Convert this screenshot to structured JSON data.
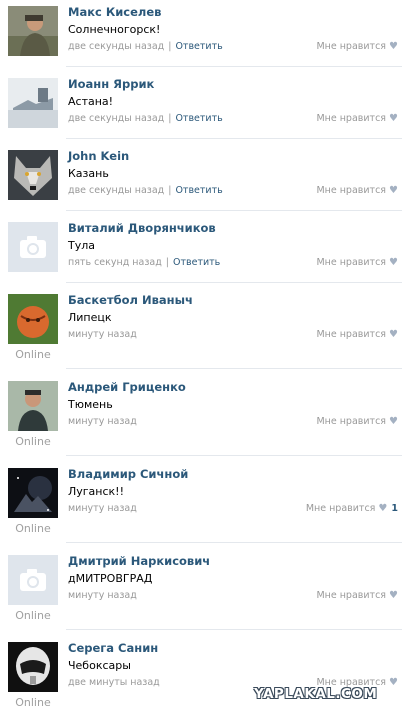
{
  "comments": [
    {
      "name": "Макс Киселев",
      "text": "Солнечногорск!",
      "time": "две секунды назад",
      "reply": "Ответить",
      "like": "Мне нравится",
      "online": "",
      "avatar_icon": "user-photo-icon"
    },
    {
      "name": "Иоанн Яррик",
      "text": "Астана!",
      "time": "две секунды назад",
      "reply": "Ответить",
      "like": "Мне нравится",
      "online": "",
      "avatar_icon": "user-photo-icon"
    },
    {
      "name": "John Kein",
      "text": "Казань",
      "time": "две секунды назад",
      "reply": "Ответить",
      "like": "Мне нравится",
      "online": "",
      "avatar_icon": "wolf-photo-icon"
    },
    {
      "name": "Виталий Дворянчиков",
      "text": "Тула",
      "time": "пять секунд назад",
      "reply": "Ответить",
      "like": "Мне нравится",
      "online": "",
      "avatar_icon": "camera-placeholder-icon"
    },
    {
      "name": "Баскетбол Иваныч",
      "text": "Липецк",
      "time": "минуту назад",
      "reply": "",
      "like": "Мне нравится",
      "online": "Online",
      "avatar_icon": "basketball-photo-icon"
    },
    {
      "name": "Андрей Гриценко",
      "text": "Тюмень",
      "time": "минуту назад",
      "reply": "",
      "like": "Мне нравится",
      "online": "Online",
      "avatar_icon": "user-photo-icon"
    },
    {
      "name": "Владимир Сичной",
      "text": "Луганск!!",
      "time": "минуту назад",
      "reply": "",
      "like": "Мне нравится",
      "like_count": "1",
      "online": "Online",
      "avatar_icon": "space-photo-icon"
    },
    {
      "name": "Дмитрий Наркисович",
      "text": "дМИТРОВГРАД",
      "time": "минуту назад",
      "reply": "",
      "like": "Мне нравится",
      "online": "Online",
      "avatar_icon": "camera-placeholder-icon"
    },
    {
      "name": "Серега Санин",
      "text": "Чебоксары",
      "time": "две минуты назад",
      "reply": "",
      "like": "Мне нравится",
      "online": "Online",
      "avatar_icon": "helmet-photo-icon"
    }
  ],
  "watermark": "YAPLAKAL.COM",
  "colors": {
    "name": "#2b587a",
    "meta": "#999999",
    "separator": "#e4e8ed",
    "placeholder_bg": "#dfe5ec",
    "heart": "#a4b1c2"
  }
}
